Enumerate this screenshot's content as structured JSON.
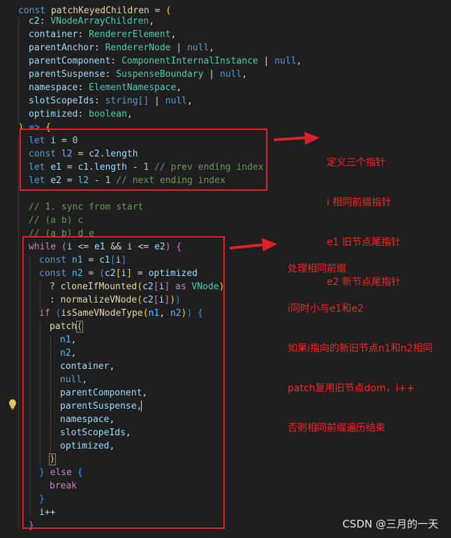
{
  "code": {
    "title_keyword": "const",
    "function_name": "patchKeyedChildren",
    "params": [
      {
        "name": "c2",
        "type": "VNodeArrayChildren"
      },
      {
        "name": "container",
        "type": "RendererElement"
      },
      {
        "name": "parentAnchor",
        "type": "RendererNode",
        "extra": "null"
      },
      {
        "name": "parentComponent",
        "type": "ComponentInternalInstance",
        "extra": "null"
      },
      {
        "name": "parentSuspense",
        "type": "SuspenseBoundary",
        "extra": "null"
      },
      {
        "name": "namespace",
        "type": "ElementNamespace"
      },
      {
        "name": "slotScopeIds",
        "type": "string[]",
        "extra": "null"
      },
      {
        "name": "optimized",
        "type": "boolean"
      }
    ],
    "comment_sync": "// 1. sync from start",
    "comment_ab_c": "// (a b) c",
    "comment_ab_de": "// (a b) d e",
    "comment_prev_ending": "// prev ending index",
    "comment_next_ending": "// next ending index"
  },
  "annotations": {
    "top_note": [
      "定义三个指针",
      "i 相同前缀指针",
      "e1 旧节点尾指针",
      "e2 新节点尾指针"
    ],
    "bottom_note": [
      "处理相同前缀",
      "i同时小与e1和e2",
      "如果i指向的新旧节点n1和n2相同",
      "patch复用旧节点dom，i++",
      "否则相同前缀遍历结束"
    ]
  },
  "watermark": "CSDN @三月的一天",
  "colors": {
    "annotation_red": "#e0202a",
    "background": "#1f1f1f"
  }
}
